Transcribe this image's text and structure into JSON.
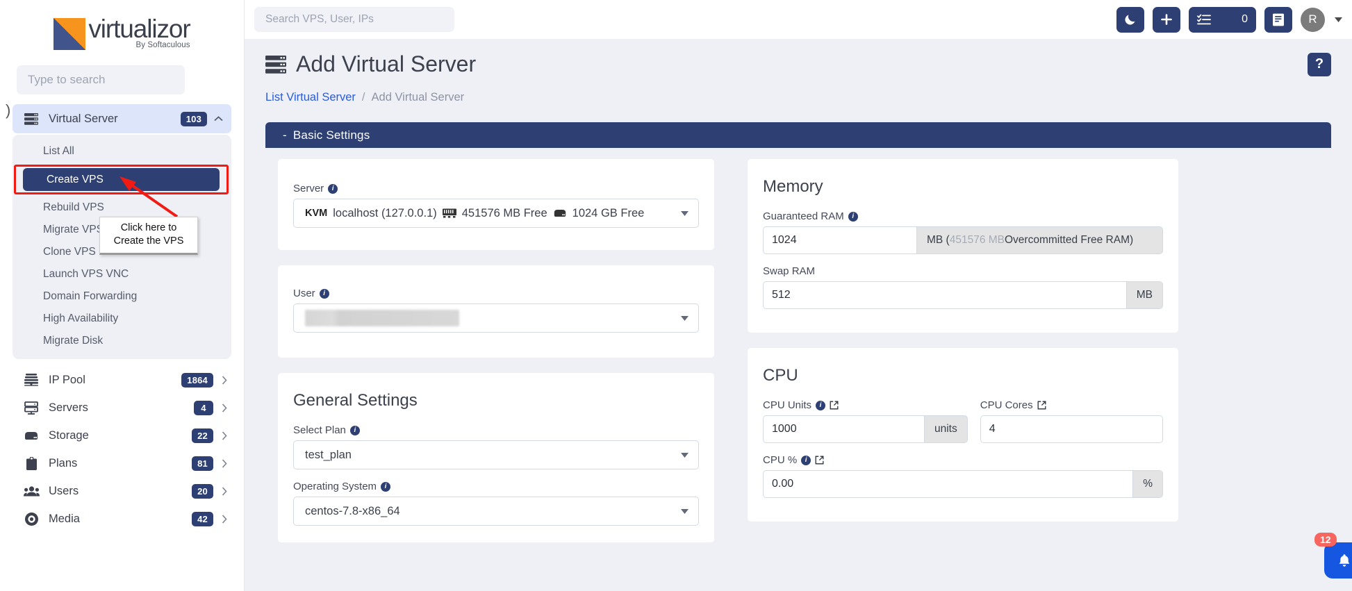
{
  "brand": {
    "name": "virtualizor",
    "tagline": "By Softaculous",
    "colors": {
      "orange": "#f7941e",
      "navy": "#2d3f73",
      "accent_blue": "#2b5bd7",
      "alert_red": "#f21b13"
    }
  },
  "sidebar": {
    "search_placeholder": "Type to search",
    "group": {
      "label": "Virtual Server",
      "badge": "103",
      "icon": "server-stack-icon",
      "expanded": true,
      "items": [
        {
          "label": "List All",
          "selected": false
        },
        {
          "label": "Create VPS",
          "selected": true
        },
        {
          "label": "Rebuild VPS",
          "selected": false
        },
        {
          "label": "Migrate VPS",
          "selected": false
        },
        {
          "label": "Clone VPS",
          "selected": false
        },
        {
          "label": "Launch VPS VNC",
          "selected": false
        },
        {
          "label": "Domain Forwarding",
          "selected": false
        },
        {
          "label": "High Availability",
          "selected": false
        },
        {
          "label": "Migrate Disk",
          "selected": false
        }
      ]
    },
    "items": [
      {
        "label": "IP Pool",
        "badge": "1864",
        "icon": "ip-pool-icon"
      },
      {
        "label": "Servers",
        "badge": "4",
        "icon": "servers-icon"
      },
      {
        "label": "Storage",
        "badge": "22",
        "icon": "storage-icon"
      },
      {
        "label": "Plans",
        "badge": "81",
        "icon": "plans-clipboard-icon"
      },
      {
        "label": "Users",
        "badge": "20",
        "icon": "users-icon"
      },
      {
        "label": "Media",
        "badge": "42",
        "icon": "media-disc-icon"
      }
    ]
  },
  "annotation": {
    "tooltip_line1": "Click here to",
    "tooltip_line2": "Create the VPS",
    "arrow_color": "#f21b13"
  },
  "topbar": {
    "search_placeholder": "Search VPS, User, IPs",
    "dark_mode_icon": "moon-icon",
    "add_icon": "plus-icon",
    "tasks_icon": "task-list-icon",
    "tasks_count": "0",
    "docs_icon": "book-icon",
    "avatar_initial": "R"
  },
  "page": {
    "title": "Add Virtual Server",
    "title_icon": "server-stack-icon",
    "help_label": "?",
    "breadcrumb": {
      "link": "List Virtual Server",
      "separator": "/",
      "current": "Add Virtual Server"
    }
  },
  "panel": {
    "collapse_symbol": "-",
    "title": "Basic Settings"
  },
  "server_card": {
    "label": "Server",
    "value_type": "KVM",
    "value_host": "localhost (127.0.0.1)",
    "ram_icon": "memory-stick-icon",
    "value_ram": "451576 MB Free",
    "disk_icon": "storage-icon",
    "value_disk": "1024 GB Free"
  },
  "user_card": {
    "label": "User",
    "value": ""
  },
  "general_settings": {
    "heading": "General Settings",
    "plan_label": "Select Plan",
    "plan_value": "test_plan",
    "os_label": "Operating System",
    "os_value": "centos-7.8-x86_64"
  },
  "memory": {
    "heading": "Memory",
    "guaranteed_label": "Guaranteed RAM",
    "guaranteed_value": "1024",
    "guaranteed_addon_prefix": "MB (",
    "guaranteed_addon_muted": "451576 MB",
    "guaranteed_addon_suffix": "Overcommitted Free RAM)",
    "swap_label": "Swap RAM",
    "swap_value": "512",
    "swap_addon": "MB"
  },
  "cpu": {
    "heading": "CPU",
    "units_label": "CPU Units",
    "units_value": "1000",
    "units_addon": "units",
    "cores_label": "CPU Cores",
    "cores_value": "4",
    "percent_label": "CPU %",
    "percent_value": "0.00",
    "percent_addon": "%"
  },
  "notification_fab": {
    "icon": "bell-icon",
    "count": "12"
  }
}
